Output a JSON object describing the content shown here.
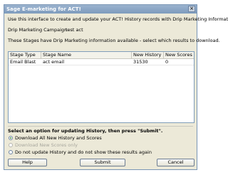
{
  "window": {
    "title": "Sage E-marketing for ACT!",
    "close_glyph": "×"
  },
  "intro_text": "Use this interface to create and update your ACT! History records with Drip Marketing Information.",
  "campaign": {
    "label": "Drip Marketing Campaign -",
    "value": "test act"
  },
  "stages_text": "These Stages have Drip Marketing information available - select which results to download.",
  "table": {
    "columns": [
      "Stage Type",
      "Stage Name",
      "New History",
      "New Scores"
    ],
    "rows": [
      [
        "Email Blast",
        "act email",
        "31530",
        "0"
      ]
    ]
  },
  "options": {
    "heading": "Select an option for updating History, then press \"Submit\".",
    "items": [
      {
        "label": "Download All New History and Scores",
        "checked": true,
        "enabled": true
      },
      {
        "label": "Download New Scores only",
        "checked": false,
        "enabled": false
      },
      {
        "label": "Do not update History and do not show these results again",
        "checked": false,
        "enabled": true
      }
    ]
  },
  "buttons": {
    "help": "Help",
    "submit": "Submit",
    "cancel": "Cancel"
  },
  "colors": {
    "titlebar": "#7d9bbd",
    "dialog_bg": "#ece9d8",
    "radio_checked": "#3b8a2e"
  }
}
